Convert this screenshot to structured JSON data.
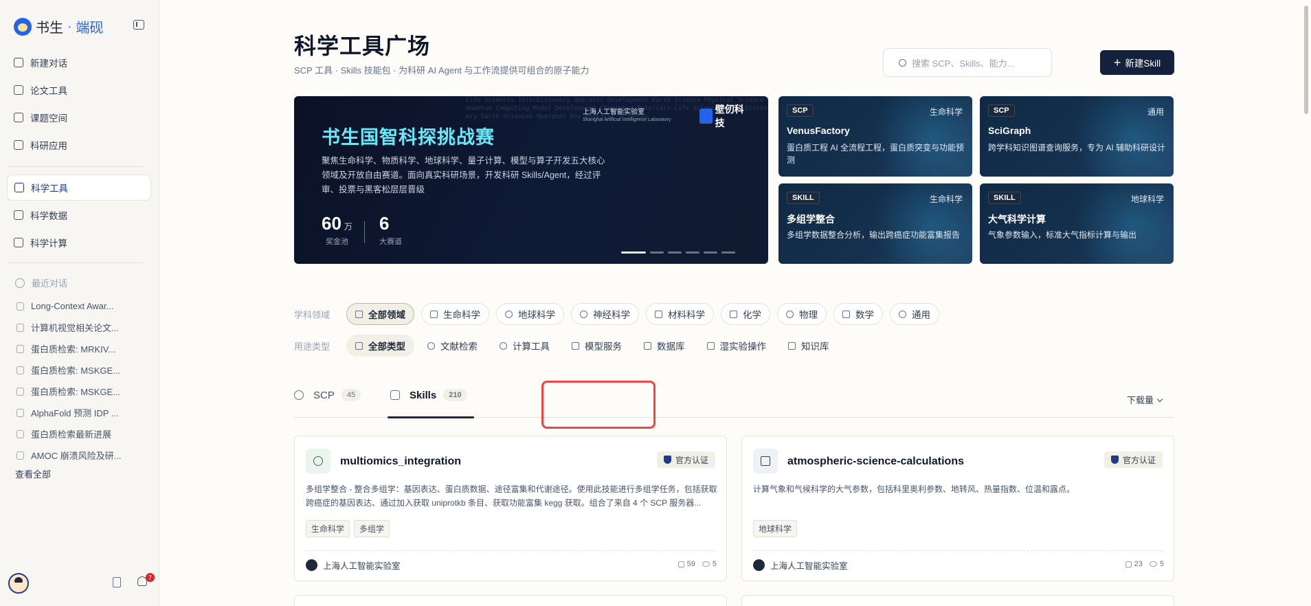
{
  "sidebar": {
    "brand_main": "书生",
    "brand_sep": "·",
    "brand_sub": "端砚",
    "nav": [
      {
        "label": "新建对话",
        "icon": "plus-square-icon"
      },
      {
        "label": "论文工具",
        "icon": "document-icon"
      },
      {
        "label": "课题空间",
        "icon": "library-icon"
      },
      {
        "label": "科研应用",
        "icon": "hexagon-icon"
      }
    ],
    "nav2": [
      {
        "label": "科学工具",
        "icon": "toolbox-icon",
        "active": true
      },
      {
        "label": "科学数据",
        "icon": "database-icon"
      },
      {
        "label": "科学计算",
        "icon": "monitor-icon"
      }
    ],
    "recent_title": "最近对话",
    "recent": [
      "Long-Context Awar...",
      "计算机视觉相关论文...",
      "蛋白质检索: MRKIV...",
      "蛋白质检索: MSKGE...",
      "蛋白质检索: MSKGE...",
      "AlphaFold 预测 IDP ...",
      "蛋白质检索最新进展",
      "AMOC 崩溃风险及研..."
    ],
    "view_all": "查看全部",
    "notification_count": "7"
  },
  "header": {
    "title": "科学工具广场",
    "subtitle": "SCP 工具 · Skills 技能包 · 为科研 AI Agent 与工作流提供可组合的原子能力",
    "search_placeholder": "搜索 SCP、Skills、能力...",
    "new_skill": "新建Skill"
  },
  "hero": {
    "title": "书生国智科探挑战赛",
    "description": "聚焦生命科学、物质科学、地球科学、量子计算、模型与算子开发五大核心领域及开放自由赛道。面向真实科研场景，开发科研 Skills/Agent，经过评审、投票与黑客松层层晋级",
    "stat1_value": "60",
    "stat1_unit": "万",
    "stat1_label": "奖金池",
    "stat2_value": "6",
    "stat2_label": "大赛道",
    "org1": "上海人工智能实验室",
    "org1_en": "Shanghai Artificial Intelligence Laboratory",
    "org2": "壁仞科技",
    "matrix_text": "Life Sciences InterDiscovery Operator Development Earth Science Physical Science Quantum Computing Model Development Chemistry Materials Life Sciences InterDiscovery Earth Sciences Operator Dev Physical Sciences"
  },
  "feature_cards": [
    {
      "tag": "SCP",
      "domain": "生命科学",
      "title": "VenusFactory",
      "desc": "蛋白质工程 AI 全流程工程，蛋白质突变与功能预测"
    },
    {
      "tag": "SCP",
      "domain": "通用",
      "title": "SciGraph",
      "desc": "跨学科知识图谱查询服务，专为 AI 辅助科研设计"
    },
    {
      "tag": "SKILL",
      "domain": "生命科学",
      "title": "多组学整合",
      "desc": "多组学数据整合分析，输出跨癌症功能富集报告"
    },
    {
      "tag": "SKILL",
      "domain": "地球科学",
      "title": "大气科学计算",
      "desc": "气象参数输入，标准大气指标计算与输出"
    }
  ],
  "filters": {
    "domain_label": "学科领域",
    "domains": [
      "全部领域",
      "生命科学",
      "地球科学",
      "神经科学",
      "材料科学",
      "化学",
      "物理",
      "数学",
      "通用"
    ],
    "type_label": "用途类型",
    "types": [
      "全部类型",
      "文献检索",
      "计算工具",
      "模型服务",
      "数据库",
      "湿实验操作",
      "知识库"
    ]
  },
  "tabs": [
    {
      "label": "SCP",
      "count": "45"
    },
    {
      "label": "Skills",
      "count": "210",
      "active": true
    }
  ],
  "sort_label": "下载量",
  "skills": [
    {
      "title": "multiomics_integration",
      "cert": "官方认证",
      "desc": "多组学整合 - 整合多组学：基因表达、蛋白质数据、途径富集和代谢途径。使用此技能进行多组学任务，包括获取跨癌症的基因表达、通过加入获取 uniprotkb 条目、获取功能富集 kegg 获取。组合了来自 4 个 SCP 服务器...",
      "tags": [
        "生命科学",
        "多组学"
      ],
      "org": "上海人工智能实验室",
      "downloads": "59",
      "views": "5"
    },
    {
      "title": "atmospheric-science-calculations",
      "cert": "官方认证",
      "desc": "计算气象和气候科学的大气参数，包括科里奥利参数、地转风、热量指数、位温和露点。",
      "tags": [
        "地球科学"
      ],
      "org": "上海人工智能实验室",
      "downloads": "23",
      "views": "5"
    }
  ]
}
